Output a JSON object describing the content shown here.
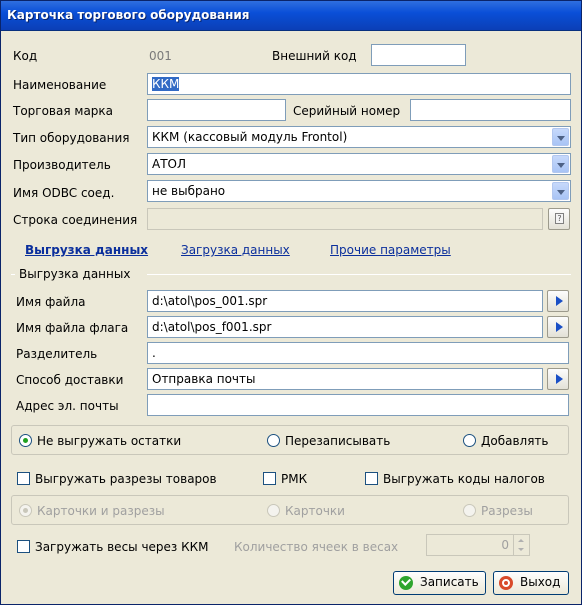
{
  "window": {
    "title": "Карточка торгового оборудования"
  },
  "fields": {
    "code_label": "Код",
    "code_value": "001",
    "external_code_label": "Внешний код",
    "external_code_value": "",
    "name_label": "Наименование",
    "name_value": "ККМ",
    "brand_label": "Торговая марка",
    "brand_value": "",
    "serial_label": "Серийный номер",
    "serial_value": "",
    "equipment_type_label": "Тип оборудования",
    "equipment_type_value": "ККМ (кассовый модуль Frontol)",
    "manufacturer_label": "Производитель",
    "manufacturer_value": "АТОЛ",
    "odbc_label": "Имя ODBC соед.",
    "odbc_value": "не выбрано",
    "connection_label": "Строка соединения",
    "connection_value": ""
  },
  "tabs": [
    {
      "label": "Выгрузка данных",
      "active": true
    },
    {
      "label": "Загрузка данных",
      "active": false
    },
    {
      "label": "Прочие параметры",
      "active": false
    }
  ],
  "export": {
    "group_label": "Выгрузка данных",
    "file_label": "Имя файла",
    "file_value": "d:\\atol\\pos_001.spr",
    "flag_file_label": "Имя файла флага",
    "flag_file_value": "d:\\atol\\pos_f001.spr",
    "separator_label": "Разделитель",
    "separator_value": ".",
    "delivery_label": "Способ доставки",
    "delivery_value": "Отправка почты",
    "email_label": "Адрес эл. почты",
    "email_value": ""
  },
  "stock_options": [
    {
      "label": "Не выгружать остатки",
      "selected": true
    },
    {
      "label": "Перезаписывать",
      "selected": false
    },
    {
      "label": "Добавлять",
      "selected": false
    }
  ],
  "checkboxes": {
    "export_slices": "Выгружать разрезы товаров",
    "rmk": "РМК",
    "export_tax_codes": "Выгружать коды налогов"
  },
  "slice_options": [
    {
      "label": "Карточки и разрезы",
      "selected": true
    },
    {
      "label": "Карточки",
      "selected": false
    },
    {
      "label": "Разрезы",
      "selected": false
    }
  ],
  "scales": {
    "load_label": "Загружать весы через ККМ",
    "cells_label": "Количество ячеек в весах",
    "cells_value": "0"
  },
  "buttons": {
    "save": "Записать",
    "exit": "Выход"
  },
  "colors": {
    "title_bar": "#0a4fd8",
    "window_bg": "#ece9d8",
    "link": "#0b2f9c",
    "selection": "#316ac5"
  }
}
